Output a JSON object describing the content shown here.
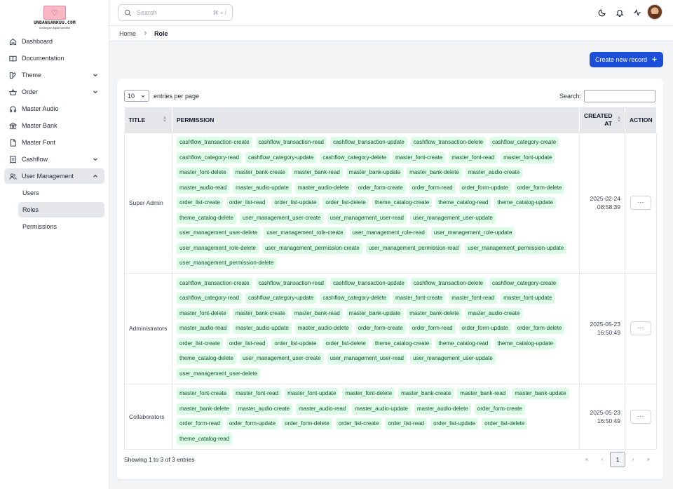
{
  "brand": {
    "name": "UNDANGANKUU.COM",
    "tagline": "undangan digital website"
  },
  "sidebar": {
    "items": [
      {
        "label": "Dashboard",
        "icon": "home-icon"
      },
      {
        "label": "Documentation",
        "icon": "book-icon"
      },
      {
        "label": "Theme",
        "icon": "palette-icon",
        "expandable": true
      },
      {
        "label": "Order",
        "icon": "basket-icon",
        "expandable": true
      },
      {
        "label": "Master Audio",
        "icon": "headphones-icon"
      },
      {
        "label": "Master Bank",
        "icon": "bank-icon"
      },
      {
        "label": "Master Font",
        "icon": "file-icon"
      },
      {
        "label": "Cashflow",
        "icon": "receipt-icon",
        "expandable": true
      },
      {
        "label": "User Management",
        "icon": "users-icon",
        "expandable": true,
        "expanded": true
      }
    ],
    "sub_items": [
      {
        "label": "Users"
      },
      {
        "label": "Roles",
        "active": true
      },
      {
        "label": "Permissions"
      }
    ]
  },
  "topbar": {
    "search_placeholder": "Search",
    "shortcut": "⌘ + /"
  },
  "breadcrumb": {
    "home": "Home",
    "current": "Role"
  },
  "actions": {
    "create_label": "Create new record"
  },
  "table": {
    "length_value": "10",
    "length_suffix": "entries per page",
    "search_label": "Search:",
    "columns": {
      "title": "TITLE",
      "permission": "PERMISSION",
      "created_line1": "CREATED",
      "created_line2": "AT",
      "action": "ACTION"
    },
    "rows": [
      {
        "title": "Super Admin",
        "date": "2025-02-24",
        "time": "08:58:39",
        "action": "···",
        "permissions": [
          "cashflow_transaction-create",
          "cashflow_transaction-read",
          "cashflow_transaction-update",
          "cashflow_transaction-delete",
          "cashflow_category-create",
          "cashflow_category-read",
          "cashflow_category-update",
          "cashflow_category-delete",
          "master_font-create",
          "master_font-read",
          "master_font-update",
          "master_font-delete",
          "master_bank-create",
          "master_bank-read",
          "master_bank-update",
          "master_bank-delete",
          "master_audio-create",
          "master_audio-read",
          "master_audio-update",
          "master_audio-delete",
          "order_form-create",
          "order_form-read",
          "order_form-update",
          "order_form-delete",
          "order_list-create",
          "order_list-read",
          "order_list-update",
          "order_list-delete",
          "theme_catalog-create",
          "theme_catalog-read",
          "theme_catalog-update",
          "theme_catalog-delete",
          "user_management_user-create",
          "user_management_user-read",
          "user_management_user-update",
          "user_management_user-delete",
          "user_management_role-create",
          "user_management_role-read",
          "user_management_role-update",
          "user_management_role-delete",
          "user_management_permission-create",
          "user_management_permission-read",
          "user_management_permission-update",
          "user_management_permission-delete"
        ]
      },
      {
        "title": "Administrators",
        "date": "2025-05-23",
        "time": "16:50:49",
        "action": "···",
        "permissions": [
          "cashflow_transaction-create",
          "cashflow_transaction-read",
          "cashflow_transaction-update",
          "cashflow_transaction-delete",
          "cashflow_category-create",
          "cashflow_category-read",
          "cashflow_category-update",
          "cashflow_category-delete",
          "master_font-create",
          "master_font-read",
          "master_font-update",
          "master_font-delete",
          "master_bank-create",
          "master_bank-read",
          "master_bank-update",
          "master_bank-delete",
          "master_audio-create",
          "master_audio-read",
          "master_audio-update",
          "master_audio-delete",
          "order_form-create",
          "order_form-read",
          "order_form-update",
          "order_form-delete",
          "order_list-create",
          "order_list-read",
          "order_list-update",
          "order_list-delete",
          "theme_catalog-create",
          "theme_catalog-read",
          "theme_catalog-update",
          "theme_catalog-delete",
          "user_management_user-create",
          "user_management_user-read",
          "user_management_user-update",
          "user_management_user-delete"
        ]
      },
      {
        "title": "Collaborators",
        "date": "2025-05-23",
        "time": "16:50:49",
        "action": "···",
        "permissions": [
          "master_font-create",
          "master_font-read",
          "master_font-update",
          "master_font-delete",
          "master_bank-create",
          "master_bank-read",
          "master_bank-update",
          "master_bank-delete",
          "master_audio-create",
          "master_audio-read",
          "master_audio-update",
          "master_audio-delete",
          "order_form-create",
          "order_form-read",
          "order_form-update",
          "order_form-delete",
          "order_list-create",
          "order_list-read",
          "order_list-update",
          "order_list-delete",
          "theme_catalog-read"
        ]
      }
    ],
    "info": "Showing 1 to 3 of 3 entries",
    "pagination": {
      "first": "«",
      "prev": "‹",
      "current": "1",
      "next": "›",
      "last": "»"
    }
  },
  "colors": {
    "primary": "#1d4ed8",
    "chip_bg": "#dcfce7",
    "chip_text": "#14532d"
  }
}
